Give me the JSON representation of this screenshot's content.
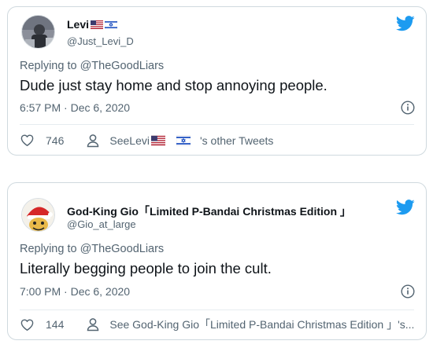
{
  "colors": {
    "twitter_blue": "#1d9bf0",
    "text_primary": "#0f1419",
    "text_secondary": "#536471",
    "border": "#cfd9de"
  },
  "tweets": [
    {
      "display_name": "Levi",
      "name_emoji": [
        "us-flag",
        "israel-flag"
      ],
      "handle": "@Just_Levi_D",
      "reply_prefix": "Replying to ",
      "reply_to": "@TheGoodLiars",
      "text": "Dude just stay home and stop annoying people.",
      "timestamp": "6:57 PM · Dec 6, 2020",
      "likes": "746",
      "see_prefix": "See ",
      "see_name": "Levi",
      "see_suffix": "'s other Tweets"
    },
    {
      "display_name": "God-King Gio「Limited P-Bandai Christmas Edition 」",
      "handle": "@Gio_at_large",
      "reply_prefix": "Replying to ",
      "reply_to": "@TheGoodLiars",
      "text": "Literally begging people to join the cult.",
      "timestamp": "7:00 PM · Dec 6, 2020",
      "likes": "144",
      "see_text": "See God-King Gio「Limited P-Bandai Christmas Edition 」's..."
    }
  ]
}
